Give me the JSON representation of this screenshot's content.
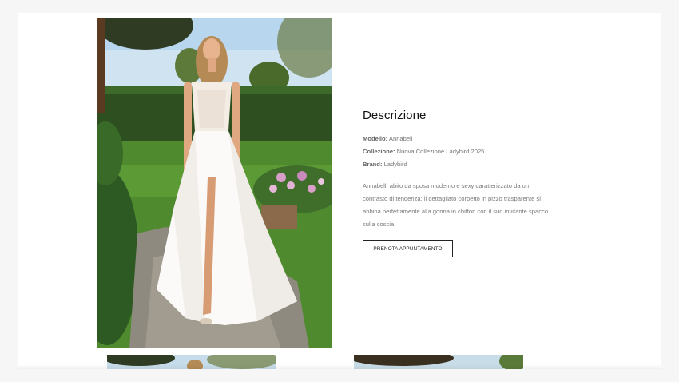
{
  "product": {
    "image_alt": "Annabell wedding dress",
    "description_title": "Descrizione",
    "model_label": "Modello:",
    "model_value": "Annabell",
    "collection_label": "Collezione:",
    "collection_value": "Nuova Collezione Ladybird 2025",
    "brand_label": "Brand:",
    "brand_value": "Ladybird",
    "description_line1": "Annabell, abito da sposa moderno e sexy caratterizzato da un",
    "description_line2": "contrasto di tendenza: il dettagliato corpetto in pizzo trasparente si",
    "description_line3": "abbina perfettamente alla gonna in chiffon con il suo invitante spacco",
    "description_line4": "sulla coscia.",
    "cta_label": "PRENOTA APPUNTAMENTO"
  },
  "colors": {
    "background": "#f6f6f6",
    "card": "#ffffff",
    "text": "#111111",
    "muted": "#777777"
  }
}
